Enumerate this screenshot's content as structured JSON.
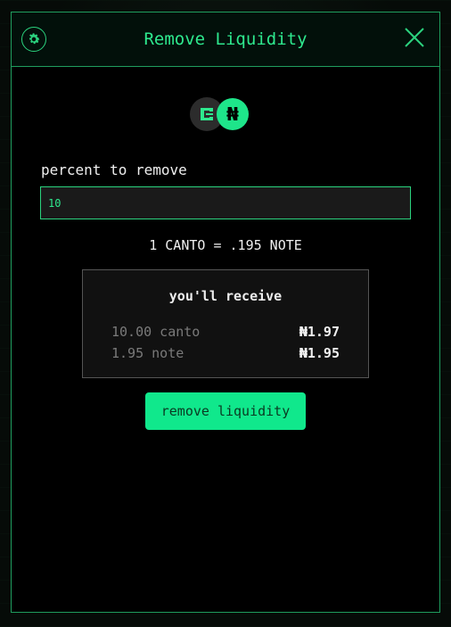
{
  "modal": {
    "title": "Remove Liquidity"
  },
  "tokens": {
    "note_symbol": "₦"
  },
  "form": {
    "label": "percent to remove",
    "value": "10"
  },
  "rate": "1 CANTO = .195 NOTE",
  "receive": {
    "title": "you'll receive",
    "rows": [
      {
        "name": "10.00 canto",
        "amount": "₦1.97"
      },
      {
        "name": "1.95 note",
        "amount": "₦1.95"
      }
    ]
  },
  "action": {
    "label": "remove liquidity"
  },
  "colors": {
    "accent": "#2ee88e",
    "button": "#10e88c",
    "border": "#1f9d5e"
  },
  "icons": {
    "settings": "gear-icon",
    "close": "close-icon",
    "token_a": "canto-token-icon",
    "token_b": "note-token-icon"
  }
}
